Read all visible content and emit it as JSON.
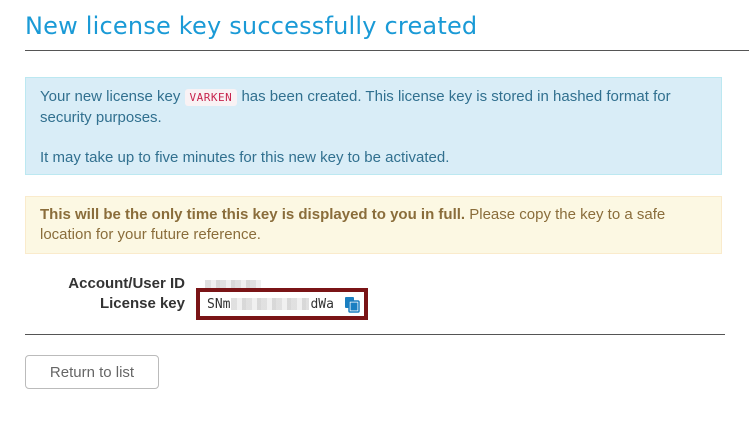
{
  "page": {
    "title": "New license key successfully created"
  },
  "info_alert": {
    "text_before": "Your new license key ",
    "key_name": "VARKEN",
    "text_after": " has been created. This license key is stored in hashed format for security purposes.",
    "activation_note": "It may take up to five minutes for this new key to be activated."
  },
  "warning_alert": {
    "bold_text": "This will be the only time this key is displayed to you in full.",
    "rest_text": " Please copy the key to a safe location for your future reference."
  },
  "details": {
    "account_label": "Account/User ID",
    "license_label": "License key",
    "key_prefix": "SNm",
    "key_suffix": "dWa",
    "copy_icon": "clipboard-copy-icon"
  },
  "actions": {
    "return_label": "Return to list"
  },
  "colors": {
    "title": "#1a9ad6",
    "info_bg": "#d9edf7",
    "info_text": "#31708f",
    "warn_bg": "#fcf8e3",
    "warn_text": "#8a6d3b",
    "highlight_border": "#7a1416",
    "copy_icon": "#1a7fc1"
  }
}
